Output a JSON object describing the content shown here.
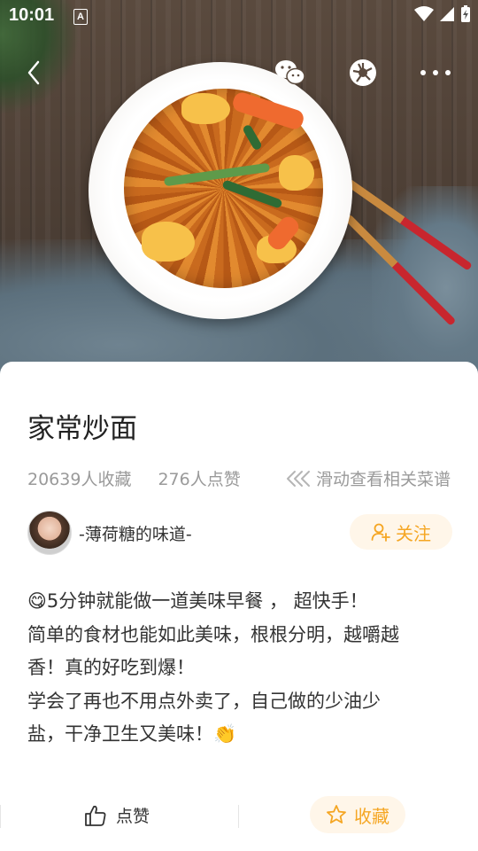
{
  "status_bar": {
    "time": "10:01",
    "notification_icon": "A"
  },
  "hero": {
    "image_description_icon": "stir-fried-noodles-photo",
    "nav": {
      "back_icon": "chevron-left-icon",
      "wechat_icon": "wechat-icon",
      "moments_icon": "aperture-icon",
      "more_icon": "more-dots-icon"
    }
  },
  "recipe": {
    "title": "家常炒面",
    "favorites_count": "20639人收藏",
    "likes_count": "276人点赞",
    "swipe_hint": "滑动查看相关菜谱"
  },
  "author": {
    "name": "-薄荷糖的味道-",
    "follow_label": "关注"
  },
  "description": {
    "line1": "5分钟就能做一道美味早餐 ， 超快手！",
    "line2": "简单的食材也能如此美味，根根分明，越嚼越",
    "line3": "香！真的好吃到爆！",
    "line4": "学会了再也不用点外卖了，自己做的少油少",
    "line5": "盐，干净卫生又美味！",
    "emoji_start": "😋",
    "emoji_end": "👏"
  },
  "bottom_bar": {
    "like_label": "点赞",
    "favorite_label": "收藏"
  },
  "colors": {
    "accent": "#f5a623",
    "accent_bg": "#fff6e9",
    "text_primary": "#222222",
    "text_secondary": "#9a9a9a"
  }
}
